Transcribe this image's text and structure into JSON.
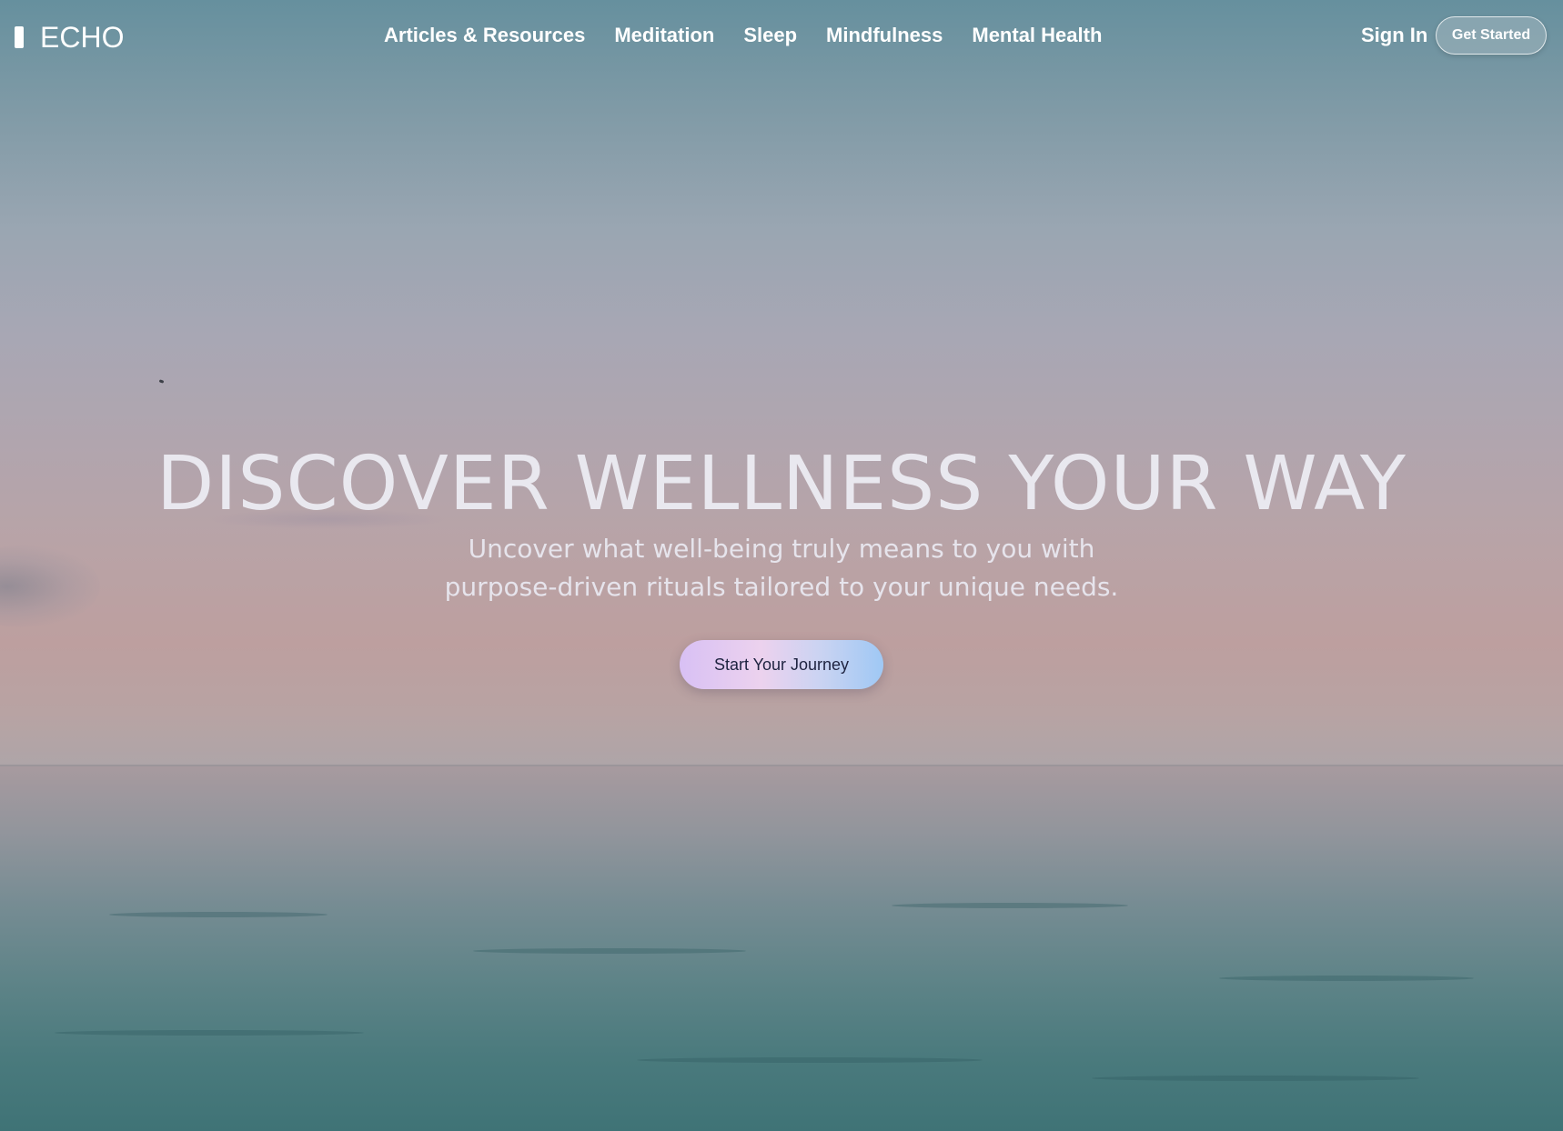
{
  "brand": {
    "name": "ECHO"
  },
  "nav": {
    "items": [
      {
        "label": "Articles & Resources"
      },
      {
        "label": "Meditation"
      },
      {
        "label": "Sleep"
      },
      {
        "label": "Mindfulness"
      },
      {
        "label": "Mental Health"
      }
    ],
    "sign_in_label": "Sign In",
    "get_started_label": "Get Started"
  },
  "hero": {
    "headline": "DISCOVER WELLNESS YOUR WAY",
    "subline_1": "Uncover what well-being truly means to you with",
    "subline_2": "purpose-driven rituals tailored to your unique needs.",
    "cta_label": "Start Your Journey"
  },
  "colors": {
    "cta_gradient_start": "#d8c0f4",
    "cta_gradient_end": "#9fc8f4",
    "cta_text": "#1e2340",
    "headline_text": "#e9e8ef"
  }
}
